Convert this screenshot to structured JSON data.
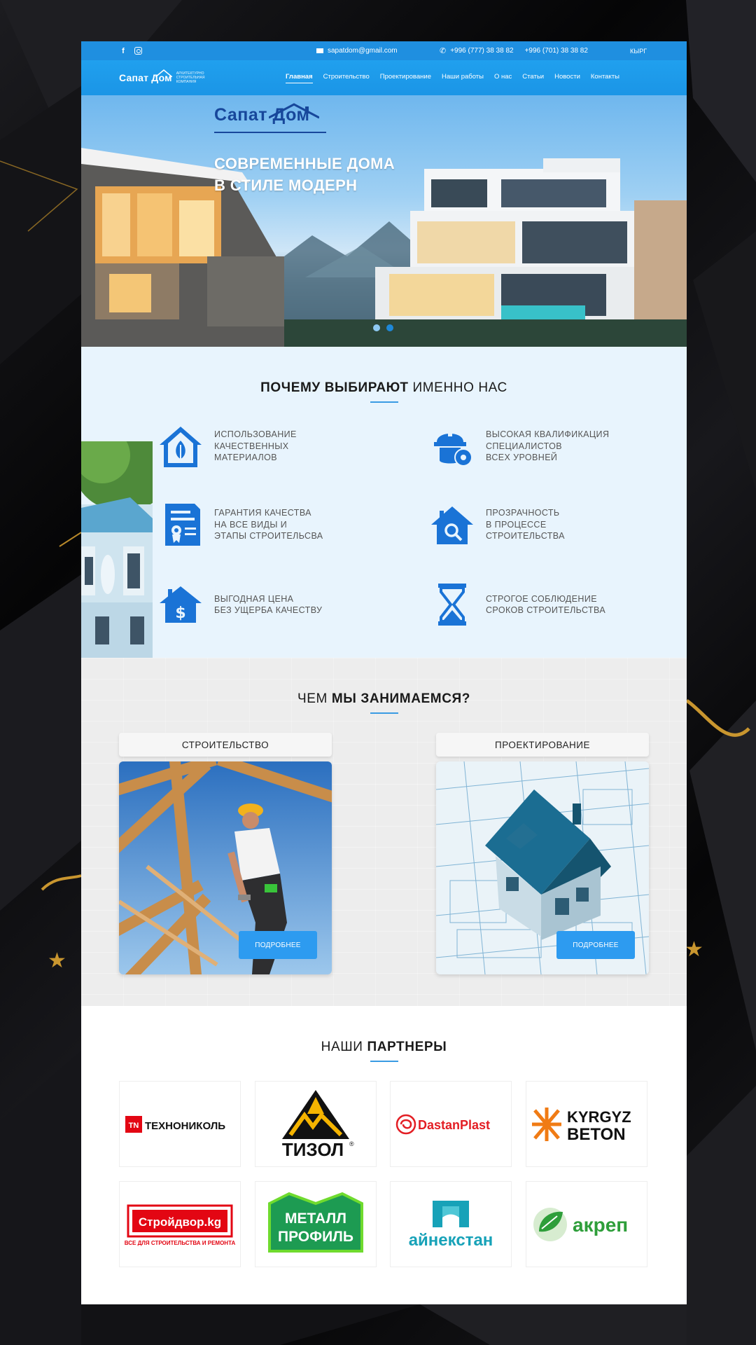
{
  "topbar": {
    "email": "sapatdom@gmail.com",
    "phone1": "+996 (777) 38 38 82",
    "phone2": "+996 (701) 38 38 82",
    "lang": "КЫРГ",
    "facebook_icon": "facebook-icon",
    "instagram_icon": "instagram-icon"
  },
  "brand": {
    "name": "Сапат Дом",
    "tagline": "Архитектурно строительная компания"
  },
  "menu": [
    {
      "label": "Главная",
      "active": true
    },
    {
      "label": "Строительство"
    },
    {
      "label": "Проектирование"
    },
    {
      "label": "Наши работы"
    },
    {
      "label": "О нас"
    },
    {
      "label": "Статьи"
    },
    {
      "label": "Новости"
    },
    {
      "label": "Контакты"
    }
  ],
  "hero": {
    "logo": "Сапат Дом",
    "title_line1": "СОВРЕМЕННЫЕ ДОМА",
    "title_line2": "В СТИЛЕ МОДЕРН",
    "slides": 2,
    "active_slide": 1
  },
  "why": {
    "title_bold": "ПОЧЕМУ ВЫБИРАЮТ",
    "title_rest": "ИМЕННО НАС",
    "features": [
      {
        "icon": "house-leaf-icon",
        "lines": [
          "ИСПОЛЬЗОВАНИЕ",
          "КАЧЕСТВЕННЫХ",
          "МАТЕРИАЛОВ"
        ]
      },
      {
        "icon": "worker-gear-icon",
        "lines": [
          "ВЫСОКАЯ КВАЛИФИКАЦИЯ",
          "СПЕЦИАЛИСТОВ",
          "ВСЕХ УРОВНЕЙ"
        ]
      },
      {
        "icon": "certificate-icon",
        "lines": [
          "ГАРАНТИЯ КАЧЕСТВА",
          "НА ВСЕ ВИДЫ И",
          "ЭТАПЫ СТРОИТЕЛЬСВА"
        ]
      },
      {
        "icon": "house-search-icon",
        "lines": [
          "ПРОЗРАЧНОСТЬ",
          "В ПРОЦЕССЕ",
          "СТРОИТЕЛЬСТВА"
        ]
      },
      {
        "icon": "house-dollar-icon",
        "lines": [
          "ВЫГОДНАЯ ЦЕНА",
          "БЕЗ УЩЕРБА КАЧЕСТВУ"
        ]
      },
      {
        "icon": "hourglass-icon",
        "lines": [
          "СТРОГОЕ СОБЛЮДЕНИЕ",
          "СРОКОВ СТРОИТЕЛЬСТВА"
        ]
      }
    ]
  },
  "services": {
    "title_rest": "ЧЕМ",
    "title_bold": "МЫ ЗАНИМАЕМСЯ?",
    "items": [
      {
        "label": "СТРОИТЕЛЬСТВО",
        "button": "ПОДРОБНЕЕ"
      },
      {
        "label": "ПРОЕКТИРОВАНИЕ",
        "button": "ПОДРОБНЕЕ"
      }
    ]
  },
  "partners": {
    "title_rest": "НАШИ",
    "title_bold": "ПАРТНЕРЫ",
    "logos": [
      {
        "name": "ТЕХНОНИКОЛЬ",
        "mark": "TN"
      },
      {
        "name": "ТИЗОЛ",
        "mark": "®"
      },
      {
        "name": "DastanPlast"
      },
      {
        "name1": "KYRGYZ",
        "name2": "BETON"
      },
      {
        "name": "Стройдвор.kg",
        "sub": "ВСЕ ДЛЯ СТРОИТЕЛЬСТВА И РЕМОНТА"
      },
      {
        "name1": "МЕТАЛЛ",
        "name2": "ПРОФИЛЬ"
      },
      {
        "name": "айнекстан"
      },
      {
        "name": "акреп"
      }
    ]
  },
  "colors": {
    "primary": "#1f8fe0",
    "dark_blue": "#17479b",
    "light_bg": "#e8f4fd",
    "button": "#2d9bf0",
    "gold": "#c9962f"
  }
}
